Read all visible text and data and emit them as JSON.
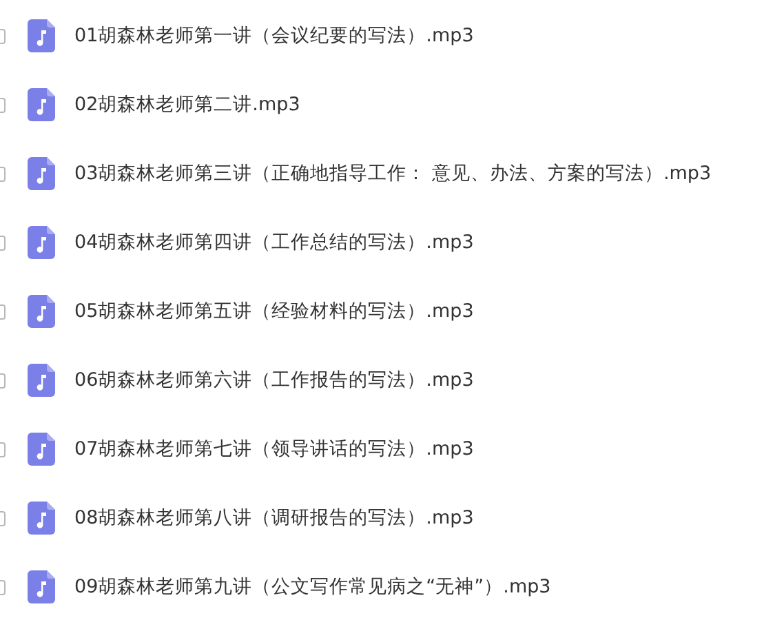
{
  "files": [
    {
      "name": "01胡森林老师第一讲（会议纪要的写法）.mp3",
      "checked": false
    },
    {
      "name": "02胡森林老师第二讲.mp3",
      "checked": false
    },
    {
      "name": "03胡森林老师第三讲（正确地指导工作： 意见、办法、方案的写法）.mp3",
      "checked": false
    },
    {
      "name": "04胡森林老师第四讲（工作总结的写法）.mp3",
      "checked": false
    },
    {
      "name": "05胡森林老师第五讲（经验材料的写法）.mp3",
      "checked": false
    },
    {
      "name": "06胡森林老师第六讲（工作报告的写法）.mp3",
      "checked": false
    },
    {
      "name": "07胡森林老师第七讲（领导讲话的写法）.mp3",
      "checked": false
    },
    {
      "name": "08胡森林老师第八讲（调研报告的写法）.mp3",
      "checked": false
    },
    {
      "name": "09胡森林老师第九讲（公文写作常见病之“无神”）.mp3",
      "checked": false
    }
  ]
}
